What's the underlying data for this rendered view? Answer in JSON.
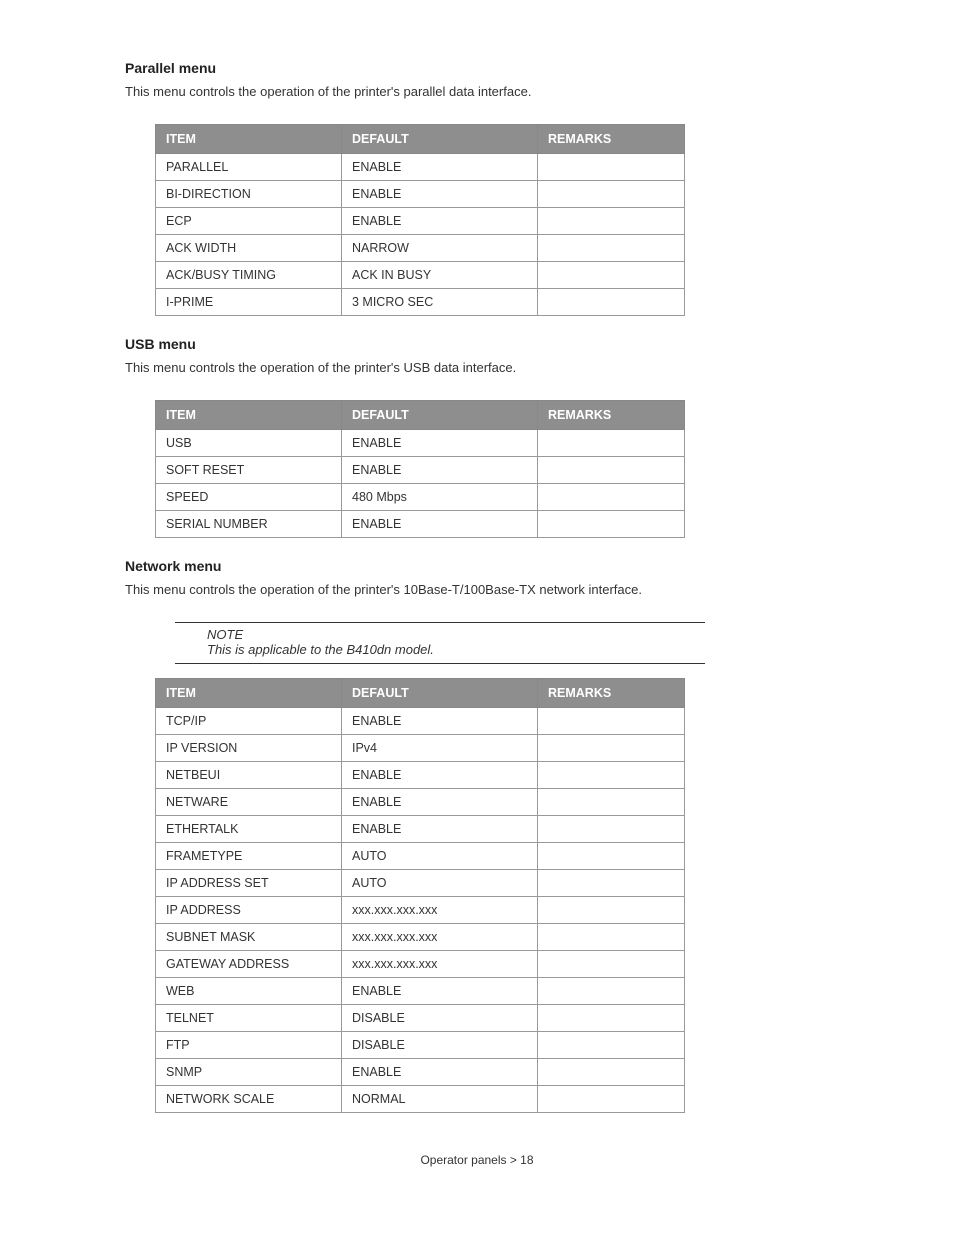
{
  "sections": {
    "parallel": {
      "heading": "Parallel menu",
      "desc": "This menu controls the operation of the printer's parallel data interface.",
      "headers": {
        "item": "ITEM",
        "default": "DEFAULT",
        "remarks": "REMARKS"
      },
      "rows": [
        {
          "item": "PARALLEL",
          "default": "ENABLE",
          "remarks": ""
        },
        {
          "item": "BI-DIRECTION",
          "default": "ENABLE",
          "remarks": ""
        },
        {
          "item": "ECP",
          "default": "ENABLE",
          "remarks": ""
        },
        {
          "item": "ACK WIDTH",
          "default": "NARROW",
          "remarks": ""
        },
        {
          "item": "ACK/BUSY TIMING",
          "default": "ACK IN BUSY",
          "remarks": ""
        },
        {
          "item": "I-PRIME",
          "default": "3 MICRO SEC",
          "remarks": ""
        }
      ]
    },
    "usb": {
      "heading": "USB menu",
      "desc": "This menu controls the operation of the printer's USB data interface.",
      "headers": {
        "item": "ITEM",
        "default": "DEFAULT",
        "remarks": "REMARKS"
      },
      "rows": [
        {
          "item": "USB",
          "default": "ENABLE",
          "remarks": ""
        },
        {
          "item": "SOFT RESET",
          "default": "ENABLE",
          "remarks": ""
        },
        {
          "item": "SPEED",
          "default": "480 Mbps",
          "remarks": ""
        },
        {
          "item": "SERIAL NUMBER",
          "default": "ENABLE",
          "remarks": ""
        }
      ]
    },
    "network": {
      "heading": "Network menu",
      "desc": "This menu controls the operation of the printer's 10Base-T/100Base-TX network interface.",
      "note_label": "NOTE",
      "note_text": "This is applicable to the B410dn model.",
      "headers": {
        "item": "ITEM",
        "default": "DEFAULT",
        "remarks": "REMARKS"
      },
      "rows": [
        {
          "item": "TCP/IP",
          "default": "ENABLE",
          "remarks": ""
        },
        {
          "item": "IP VERSION",
          "default": "IPv4",
          "remarks": ""
        },
        {
          "item": "NETBEUI",
          "default": "ENABLE",
          "remarks": ""
        },
        {
          "item": "NETWARE",
          "default": "ENABLE",
          "remarks": ""
        },
        {
          "item": "ETHERTALK",
          "default": "ENABLE",
          "remarks": ""
        },
        {
          "item": "FRAMETYPE",
          "default": "AUTO",
          "remarks": ""
        },
        {
          "item": "IP ADDRESS SET",
          "default": "AUTO",
          "remarks": ""
        },
        {
          "item": "IP ADDRESS",
          "default": "xxx.xxx.xxx.xxx",
          "remarks": ""
        },
        {
          "item": "SUBNET MASK",
          "default": "xxx.xxx.xxx.xxx",
          "remarks": ""
        },
        {
          "item": "GATEWAY ADDRESS",
          "default": "xxx.xxx.xxx.xxx",
          "remarks": ""
        },
        {
          "item": "WEB",
          "default": "ENABLE",
          "remarks": ""
        },
        {
          "item": "TELNET",
          "default": "DISABLE",
          "remarks": ""
        },
        {
          "item": "FTP",
          "default": "DISABLE",
          "remarks": ""
        },
        {
          "item": "SNMP",
          "default": "ENABLE",
          "remarks": ""
        },
        {
          "item": "NETWORK SCALE",
          "default": "NORMAL",
          "remarks": ""
        }
      ]
    }
  },
  "footer": "Operator panels > 18"
}
